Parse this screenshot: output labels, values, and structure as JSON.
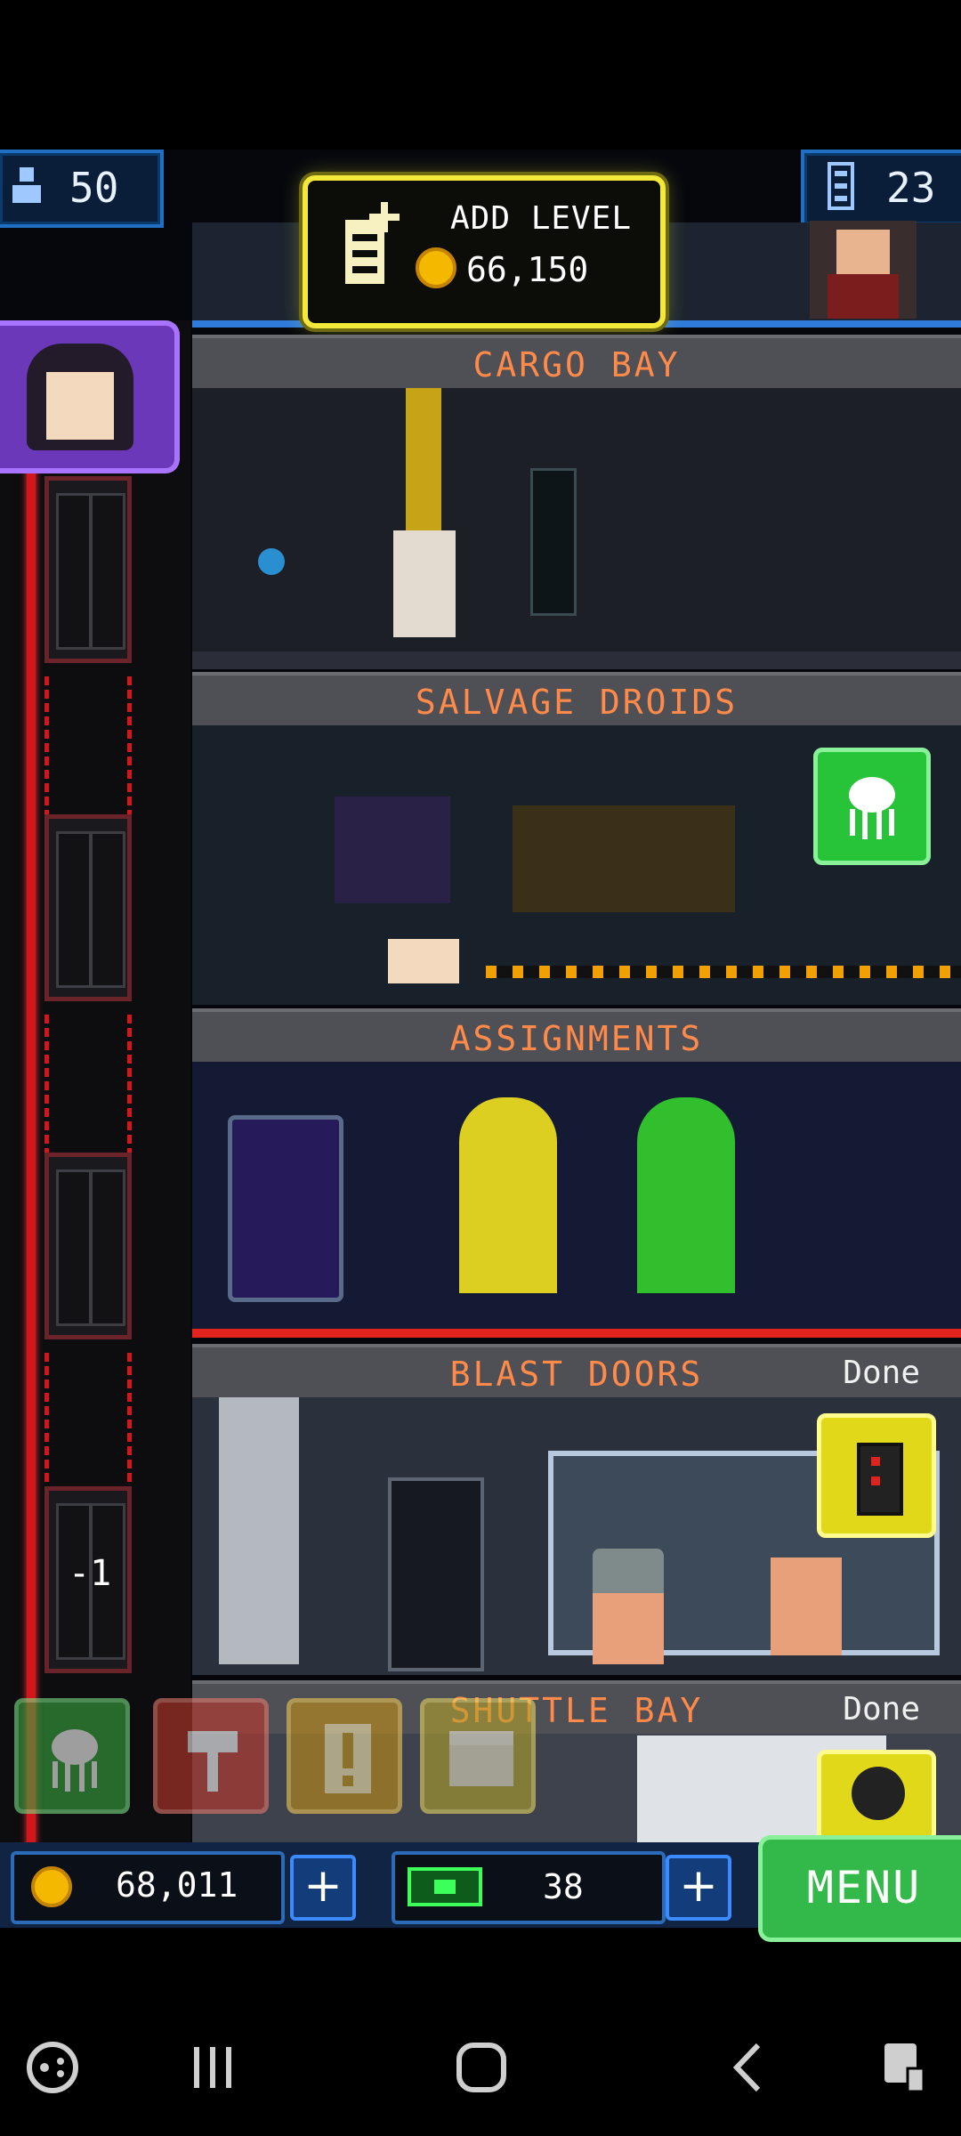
{
  "top_bar": {
    "population": "50",
    "floors": "23",
    "add_level_label": "ADD LEVEL",
    "add_level_cost": "66,150"
  },
  "floors": [
    {
      "name": "CARGO BAY",
      "status": ""
    },
    {
      "name": "SALVAGE DROIDS",
      "status": ""
    },
    {
      "name": "ASSIGNMENTS",
      "status": ""
    },
    {
      "name": "BLAST DOORS",
      "status": "Done"
    },
    {
      "name": "SHUTTLE BAY",
      "status": "Done"
    }
  ],
  "elevator": {
    "floor_indicator": "-1"
  },
  "bottom_bar": {
    "coins": "68,011",
    "bux": "38",
    "menu_label": "MENU",
    "plus_symbol": "+"
  },
  "icons": {
    "population": "person-icon",
    "floors": "floors-icon",
    "add_level": "add-level-icon",
    "coin": "coin-icon",
    "bux": "bux-icon",
    "droid": "droid-icon",
    "hammer": "hammer-icon",
    "alert": "alert-icon",
    "crate": "crate-icon"
  },
  "colors": {
    "accent_yellow": "#f2e93a",
    "accent_green": "#32b94a",
    "label_orange": "#ff8a4a",
    "frame_blue": "#1f6fc2"
  }
}
